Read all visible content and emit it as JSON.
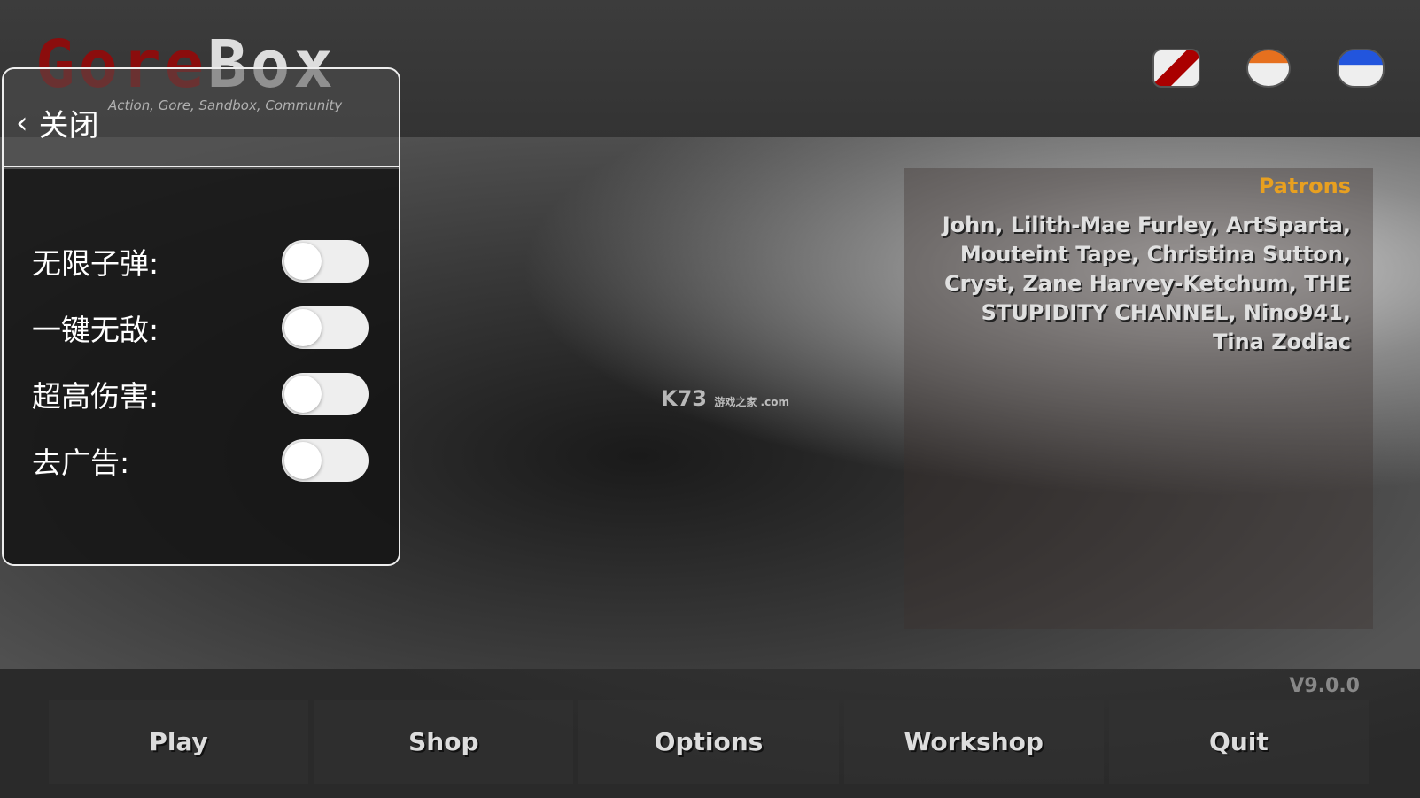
{
  "logo": {
    "text_red": "Gore",
    "text_white": "Box",
    "tagline": "Action, Gore, Sandbox, Community"
  },
  "social_icons": [
    "youtube-icon",
    "patreon-icon",
    "discord-icon"
  ],
  "patrons": {
    "title": "Patrons",
    "list": "John, Lilith-Mae Furley, ArtSparta, Mouteint Tape, Christina Sutton, Cryst, Zane Harvey-Ketchum, THE STUPIDITY CHANNEL, Nino941, Tina Zodiac"
  },
  "watermark": {
    "brand": "K73",
    "sub": "游戏之家 .com"
  },
  "version": "V9.0.0",
  "menu": [
    "Play",
    "Shop",
    "Options",
    "Workshop",
    "Quit"
  ],
  "cheat_panel": {
    "close_label": "关闭",
    "options": [
      {
        "label": "无限子弹:",
        "enabled": false
      },
      {
        "label": "一键无敌:",
        "enabled": false
      },
      {
        "label": "超高伤害:",
        "enabled": false
      },
      {
        "label": "去广告:",
        "enabled": false
      }
    ]
  },
  "colors": {
    "patrons_title": "#e8a020",
    "logo_red": "#8b0d0d"
  }
}
